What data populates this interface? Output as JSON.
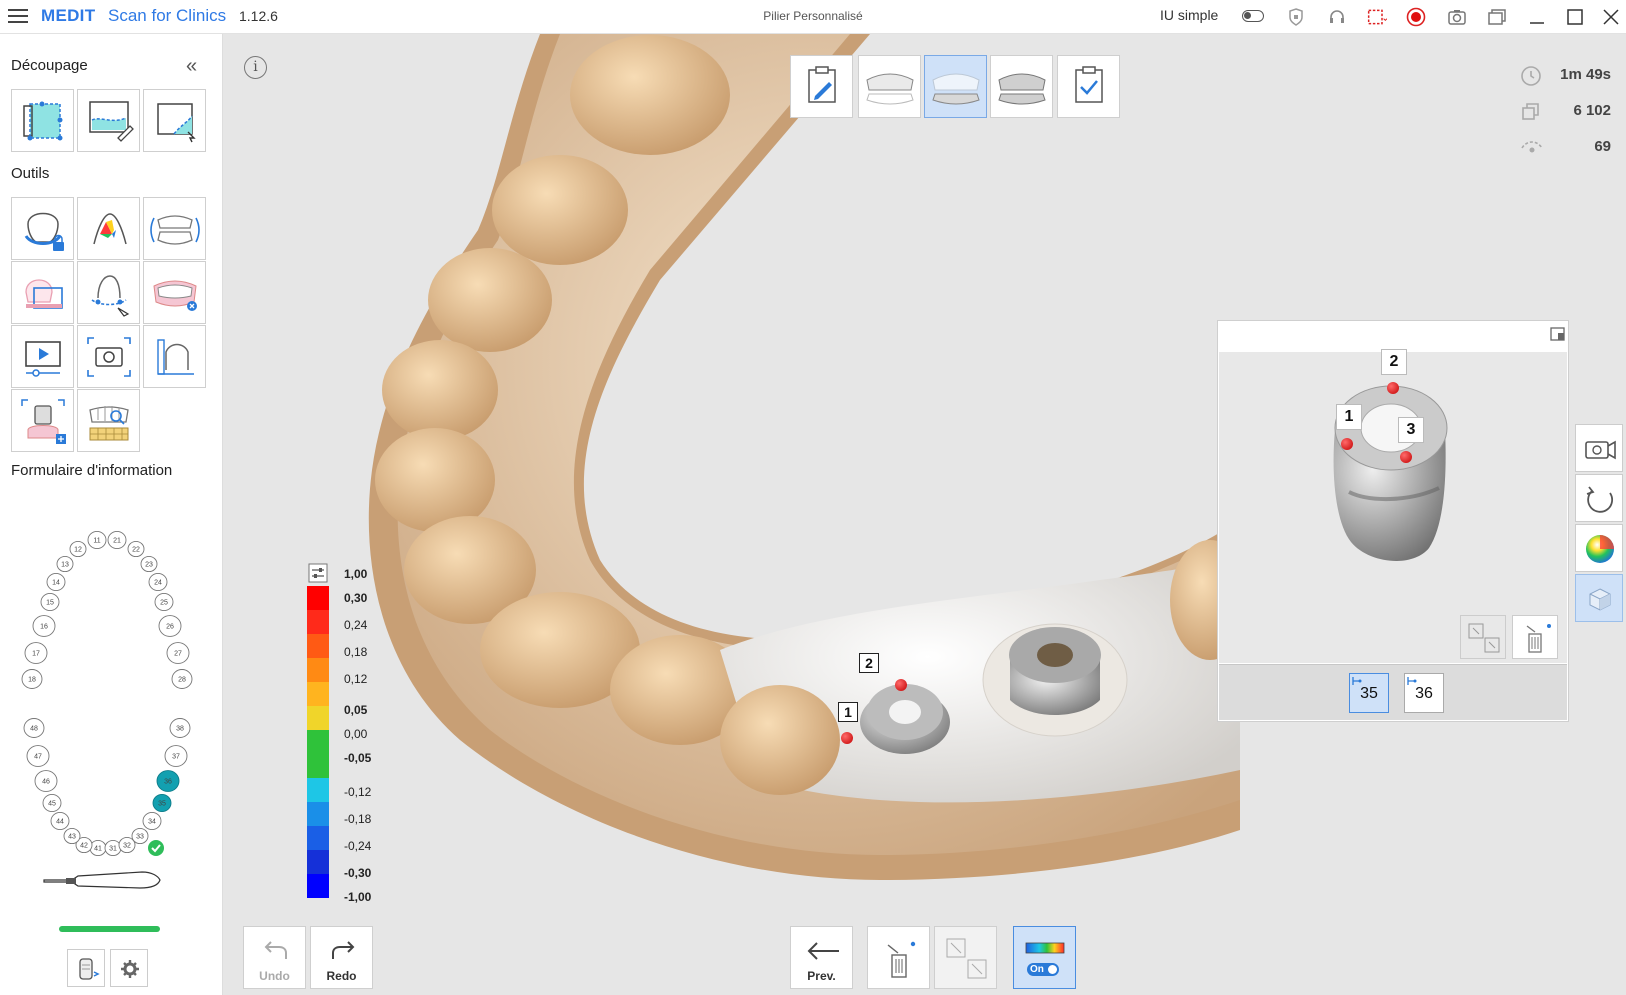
{
  "titlebar": {
    "brand": "MEDIT",
    "app_name": "Scan for Clinics",
    "version": "1.12.6",
    "window_title": "Pilier Personnalisé",
    "simple_ui_label": "IU simple",
    "icons": [
      "menu-icon",
      "shield-icon",
      "headset-icon",
      "screen-capture-icon",
      "record-icon",
      "camera-icon",
      "gallery-icon",
      "minimize-icon",
      "maximize-icon",
      "close-icon"
    ]
  },
  "sidebar": {
    "section_trim": "Découpage",
    "section_tools": "Outils",
    "section_form": "Formulaire d'information",
    "trim_tools": [
      "select-area-tool",
      "lasso-trim-tool",
      "curve-trim-tool"
    ],
    "tools": [
      "lock-tooth-tool",
      "color-analysis-tool",
      "occlusion-align-tool",
      "margin-tool",
      "margin-edit-tool",
      "arch-tool",
      "video-tool",
      "screenshot-tool",
      "measure-tool",
      "abutment-tool",
      "smile-library-tool"
    ],
    "teeth_upper_right": [
      "11",
      "12",
      "13",
      "14",
      "15",
      "16",
      "17",
      "18"
    ],
    "teeth_upper_left": [
      "21",
      "22",
      "23",
      "24",
      "25",
      "26",
      "27",
      "28"
    ],
    "teeth_lower_right": [
      "41",
      "42",
      "43",
      "44",
      "45",
      "46",
      "47",
      "48"
    ],
    "teeth_lower_left": [
      "31",
      "32",
      "33",
      "34",
      "35",
      "36",
      "37",
      "38"
    ],
    "selected_teeth": [
      "35",
      "36"
    ],
    "accent": "#13a0b0"
  },
  "steps": [
    "form-step",
    "upper-jaw-step",
    "lower-jaw-step",
    "occlusion-step",
    "review-step"
  ],
  "stats": {
    "time": "1m 49s",
    "frames": "6 102",
    "count": "69"
  },
  "legend": {
    "labels": [
      "1,00",
      "0,30",
      "0,24",
      "0,18",
      "0,12",
      "0,05",
      "0,00",
      "-0,05",
      "-0,12",
      "-0,18",
      "-0,24",
      "-0,30",
      "-1,00"
    ],
    "bold": [
      "1,00",
      "0,30",
      "0,05",
      "-0,05",
      "-0,30",
      "-1,00"
    ]
  },
  "detail": {
    "points": [
      "1",
      "2",
      "3"
    ],
    "tabs": [
      "35",
      "36"
    ],
    "active_tab": "35"
  },
  "main_points": [
    "1",
    "2"
  ],
  "bottom": {
    "undo": "Undo",
    "redo": "Redo",
    "prev": "Prev.",
    "toggle": "On"
  },
  "colors": {
    "brand": "#2f7ae5",
    "active": "#cfe1f8",
    "check": "#2fbd5a"
  }
}
